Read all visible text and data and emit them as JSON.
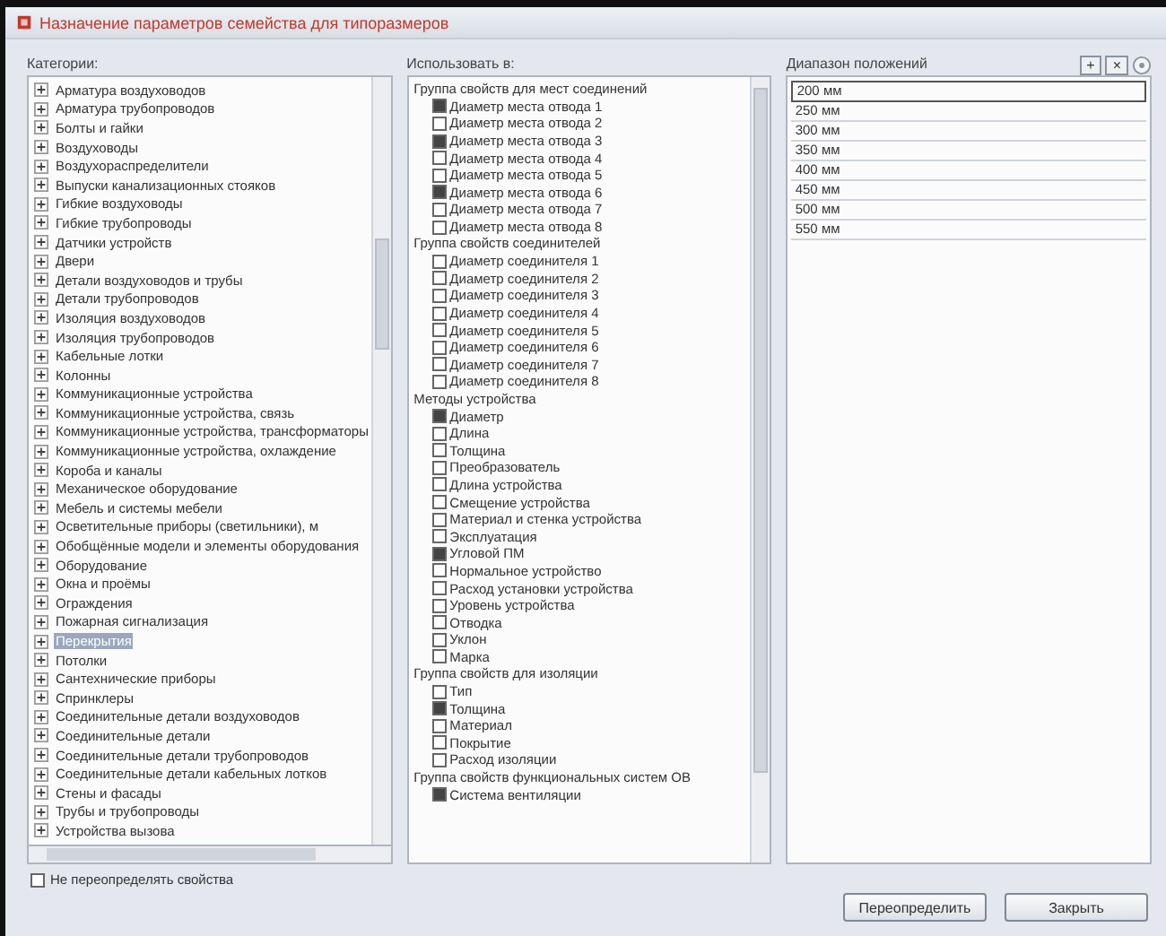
{
  "window": {
    "title": "Назначение параметров семейства для типоразмеров"
  },
  "categories": {
    "label": "Категории:",
    "items": [
      {
        "label": "Арматура воздуховодов",
        "selected": false
      },
      {
        "label": "Арматура трубопроводов",
        "selected": false
      },
      {
        "label": "Болты и гайки",
        "selected": false
      },
      {
        "label": "Воздуховоды",
        "selected": false
      },
      {
        "label": "Воздухораспределители",
        "selected": false
      },
      {
        "label": "Выпуски канализационных стояков",
        "selected": false
      },
      {
        "label": "Гибкие воздуховоды",
        "selected": false
      },
      {
        "label": "Гибкие трубопроводы",
        "selected": false
      },
      {
        "label": "Датчики устройств",
        "selected": false
      },
      {
        "label": "Двери",
        "selected": false
      },
      {
        "label": "Детали воздуховодов и трубы",
        "selected": false
      },
      {
        "label": "Детали трубопроводов",
        "selected": false
      },
      {
        "label": "Изоляция воздуховодов",
        "selected": false
      },
      {
        "label": "Изоляция трубопроводов",
        "selected": false
      },
      {
        "label": "Кабельные лотки",
        "selected": false
      },
      {
        "label": "Колонны",
        "selected": false
      },
      {
        "label": "Коммуникационные устройства",
        "selected": false
      },
      {
        "label": "Коммуникационные устройства, связь",
        "selected": false
      },
      {
        "label": "Коммуникационные устройства, трансформаторы",
        "selected": false
      },
      {
        "label": "Коммуникационные устройства, охлаждение",
        "selected": false
      },
      {
        "label": "Короба и каналы",
        "selected": false
      },
      {
        "label": "Механическое оборудование",
        "selected": false
      },
      {
        "label": "Мебель и системы мебели",
        "selected": false
      },
      {
        "label": "Осветительные приборы (светильники), м",
        "selected": false
      },
      {
        "label": "Обобщённые модели и элементы оборудования",
        "selected": false
      },
      {
        "label": "Оборудование",
        "selected": false
      },
      {
        "label": "Окна и проёмы",
        "selected": false
      },
      {
        "label": "Ограждения",
        "selected": false
      },
      {
        "label": "Пожарная сигнализация",
        "selected": false
      },
      {
        "label": "Перекрытия",
        "selected": true
      },
      {
        "label": "Потолки",
        "selected": false
      },
      {
        "label": "Сантехнические приборы",
        "selected": false
      },
      {
        "label": "Спринклеры",
        "selected": false
      },
      {
        "label": "Соединительные детали воздуховодов",
        "selected": false
      },
      {
        "label": "Соединительные детали",
        "selected": false
      },
      {
        "label": "Соединительные детали трубопроводов",
        "selected": false
      },
      {
        "label": "Соединительные детали кабельных лотков",
        "selected": false
      },
      {
        "label": "Стены и фасады",
        "selected": false
      },
      {
        "label": "Трубы и трубопроводы",
        "selected": false
      },
      {
        "label": "Устройства вызова",
        "selected": false
      }
    ]
  },
  "parameters": {
    "label": "Использовать в:",
    "groups": [
      {
        "label": "Группа свойств для мест соединений",
        "items": [
          {
            "label": "Диаметр места отвода 1",
            "checked": true
          },
          {
            "label": "Диаметр места отвода 2",
            "checked": false
          },
          {
            "label": "Диаметр места отвода 3",
            "checked": true
          },
          {
            "label": "Диаметр места отвода 4",
            "checked": false
          },
          {
            "label": "Диаметр места отвода 5",
            "checked": false
          },
          {
            "label": "Диаметр места отвода 6",
            "checked": true
          },
          {
            "label": "Диаметр места отвода 7",
            "checked": false
          },
          {
            "label": "Диаметр места отвода 8",
            "checked": false
          }
        ]
      },
      {
        "label": "Группа свойств соединителей",
        "items": [
          {
            "label": "Диаметр соединителя 1",
            "checked": false
          },
          {
            "label": "Диаметр соединителя 2",
            "checked": false
          },
          {
            "label": "Диаметр соединителя 3",
            "checked": false
          },
          {
            "label": "Диаметр соединителя 4",
            "checked": false
          },
          {
            "label": "Диаметр соединителя 5",
            "checked": false
          },
          {
            "label": "Диаметр соединителя 6",
            "checked": false
          },
          {
            "label": "Диаметр соединителя 7",
            "checked": false
          },
          {
            "label": "Диаметр соединителя 8",
            "checked": false
          }
        ]
      },
      {
        "label": "Методы устройства",
        "items": [
          {
            "label": "Диаметр",
            "checked": true
          },
          {
            "label": "Длина",
            "checked": false
          },
          {
            "label": "Толщина",
            "checked": false
          },
          {
            "label": "Преобразователь",
            "checked": false
          },
          {
            "label": "Длина устройства",
            "checked": false
          },
          {
            "label": "Смещение устройства",
            "checked": false
          },
          {
            "label": "Материал и стенка устройства",
            "checked": false
          },
          {
            "label": "Эксплуатация",
            "checked": false
          },
          {
            "label": "Угловой ПМ",
            "checked": true
          },
          {
            "label": "Нормальное устройство",
            "checked": false
          },
          {
            "label": "Расход установки устройства",
            "checked": false
          },
          {
            "label": "Уровень устройства",
            "checked": false
          },
          {
            "label": "Отводка",
            "checked": false
          },
          {
            "label": "Уклон",
            "checked": false
          },
          {
            "label": "Марка",
            "checked": false
          }
        ]
      },
      {
        "label": "Группа свойств для изоляции",
        "items": [
          {
            "label": "Тип",
            "checked": false
          },
          {
            "label": "Толщина",
            "checked": true
          },
          {
            "label": "Материал",
            "checked": false
          },
          {
            "label": "Покрытие",
            "checked": false
          },
          {
            "label": "Расход изоляции",
            "checked": false
          }
        ]
      },
      {
        "label": "Группа свойств функциональных систем ОВ",
        "items": [
          {
            "label": "Система вентиляции",
            "checked": true
          }
        ]
      }
    ]
  },
  "positions": {
    "label": "Диапазон положений",
    "add": "+",
    "remove": "×",
    "rows": [
      {
        "label": "200 мм",
        "selected": true
      },
      {
        "label": "250 мм",
        "selected": false
      },
      {
        "label": "300 мм",
        "selected": false
      },
      {
        "label": "350 мм",
        "selected": false
      },
      {
        "label": "400 мм",
        "selected": false
      },
      {
        "label": "450 мм",
        "selected": false
      },
      {
        "label": "500 мм",
        "selected": false
      },
      {
        "label": "550 мм",
        "selected": false
      }
    ]
  },
  "keep_option": {
    "label": "Не переопределять свойства",
    "checked": false
  },
  "buttons": [
    "Переопределить",
    "Закрыть"
  ]
}
